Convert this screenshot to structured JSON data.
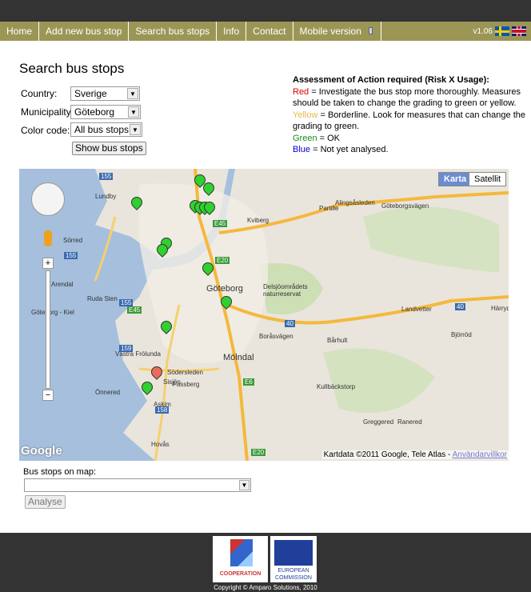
{
  "nav": {
    "items": [
      "Home",
      "Add new bus stop",
      "Search bus stops",
      "Info",
      "Contact",
      "Mobile version"
    ],
    "version": "v1.06",
    "icons": [
      "mobile-phone-icon",
      "swedish-flag-icon",
      "uk-flag-icon"
    ]
  },
  "page_title": "Search bus stops",
  "form": {
    "country_label": "Country:",
    "country_value": "Sverige",
    "municipality_label": "Municipality:",
    "municipality_value": "Göteborg",
    "color_label": "Color code:",
    "color_value": "All bus stops",
    "show_button": "Show bus stops"
  },
  "assessment": {
    "title": "Assessment of Action required (Risk X Usage):",
    "rows": [
      {
        "key": "Red",
        "text": " = Investigate the bus stop more thoroughly. Measures should be taken to change the grading to green or yellow.",
        "color": "#dd0000"
      },
      {
        "key": "Yellow",
        "text": " = Borderline. Look for measures that can change the grading to green.",
        "color": "#e8b84a"
      },
      {
        "key": "Green",
        "text": " = OK",
        "color": "#1a8a1a"
      },
      {
        "key": "Blue",
        "text": " = Not yet analysed.",
        "color": "#0000cc"
      }
    ]
  },
  "map": {
    "type_buttons": [
      "Karta",
      "Satellit"
    ],
    "active_type": "Karta",
    "attribution": "Kartdata ©2011 Google, Tele Atlas - ",
    "terms_link": "Användarvillkor",
    "logo": "Google",
    "places": [
      "Lundby",
      "Sörred",
      "Arendal",
      "Ruda Sten",
      "Göteborg - Kiel",
      "Göteborg",
      "Västra Frölunda",
      "Önnered",
      "Askim",
      "Hovås",
      "Södersleden",
      "Fassberg",
      "Mölndal",
      "Delsjöområdets naturreservat",
      "Partille",
      "Kviberg",
      "Landvetter",
      "Bårhult",
      "Härryda",
      "Björröd",
      "Kullbäckstorp",
      "Greggered",
      "Ranered",
      "Sisjön",
      "Göteborgsvägen",
      "Alingsåsleden",
      "Boråsvägen"
    ],
    "road_shields": [
      "155",
      "155",
      "155",
      "158",
      "159",
      "40",
      "40",
      "E45",
      "E45",
      "E20",
      "E20",
      "E6"
    ],
    "marker_colors": {
      "green": "#2fd12f",
      "red": "#ec6b5e"
    }
  },
  "bottom": {
    "stops_label": "Bus stops on map:",
    "stops_value": "",
    "analyse_button": "Analyse"
  },
  "footer": {
    "logo_fp7": "COOPERATION",
    "logo_ec": "EUROPEAN COMMISSION",
    "copyright": "Copyright © Amparo Solutions, 2010"
  }
}
